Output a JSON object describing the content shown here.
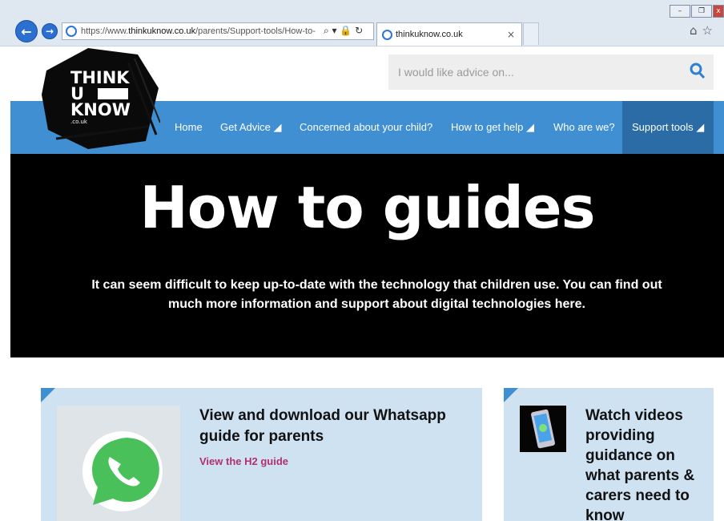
{
  "browser": {
    "url_prefix": "https://www.",
    "url_domain": "thinkuknow.co.uk",
    "url_path": "/parents/Support-tools/How-to-",
    "tab_title": "thinkuknow.co.uk",
    "tab_close": "×",
    "addr_icons": "⌕ ▾ 🔒 ↻",
    "right_icons": "⌂☆",
    "win_min": "–",
    "win_max": "❐",
    "win_close": "x"
  },
  "logo": {
    "line1": "THINK",
    "line2": "U",
    "line3": "KNOW",
    "line4": ".co.uk"
  },
  "search": {
    "placeholder": "I would like advice on..."
  },
  "nav": {
    "home": "Home",
    "get_advice": "Get Advice ◢",
    "concerned": "Concerned about your child?",
    "how_to_get_help": "How to get help ◢",
    "who_are_we": "Who are we?",
    "support_tools": "Support tools ◢"
  },
  "hero": {
    "title": "How to guides",
    "text": "It can seem difficult to keep up-to-date with the technology that children use. You can find out much more information and support about digital technologies here."
  },
  "cards": {
    "whatsapp": {
      "title": "View and download our Whatsapp guide for parents",
      "link": "View the H2 guide"
    },
    "videos": {
      "title": "Watch videos providing guidance on what parents & carers need to know"
    }
  },
  "colors": {
    "nav_blue": "#3f8fd2",
    "nav_active": "#2b6ca6",
    "card_bg": "#cfe2f2",
    "link_pink": "#b0306f"
  }
}
